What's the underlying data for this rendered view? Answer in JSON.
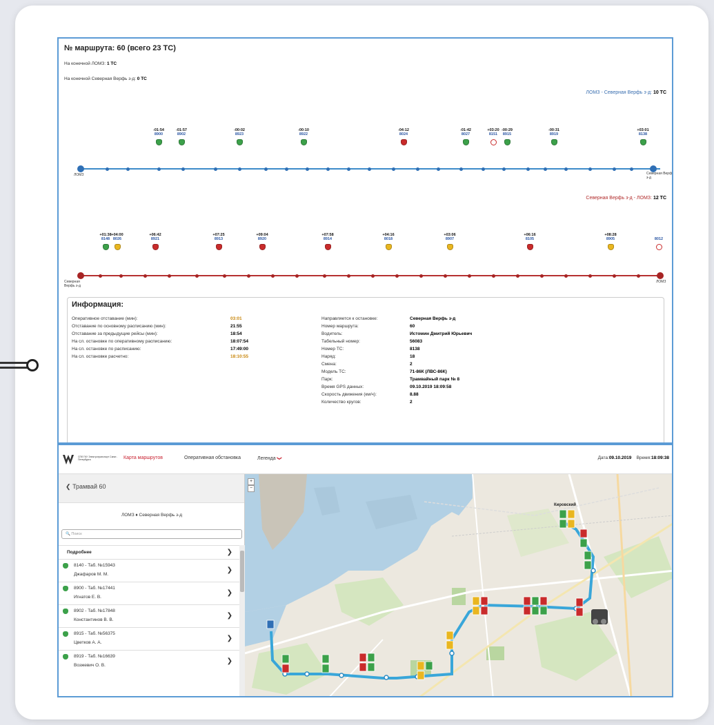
{
  "route_panel": {
    "title": "№ маршрута: 60 (всего 23 ТС)",
    "terminal_1_label": "На конечной ЛОМЗ:",
    "terminal_1_value": "1 ТС",
    "terminal_2_label": "На конечной Северная Верфь з-д:",
    "terminal_2_value": "0 ТС",
    "direction_1_label": "ЛОМЗ - Северная Верфь з-д:",
    "direction_1_count": "10 ТС",
    "direction_1_start": "ЛОМЗ",
    "direction_1_end": "Северная Верфь з-д",
    "direction_2_label": "Северная Верфь з-д - ЛОМЗ:",
    "direction_2_count": "12 ТС",
    "direction_2_start": "Северная Верфь з-д",
    "direction_2_end": "ЛОМЗ"
  },
  "direction_1_vehicles": [
    {
      "dev": "-01:54",
      "num": "8900",
      "status": "green"
    },
    {
      "dev": "-01:57",
      "num": "8902",
      "status": "green"
    },
    {
      "dev": "-00:02",
      "num": "8923",
      "status": "green"
    },
    {
      "dev": "-00:10",
      "num": "8922",
      "status": "green"
    },
    {
      "dev": "-04:12",
      "num": "8024",
      "status": "red"
    },
    {
      "dev": "-01:42",
      "num": "8027",
      "status": "green"
    },
    {
      "dev": "+03:20",
      "num": "8151",
      "status": "circle"
    },
    {
      "dev": "-00:29",
      "num": "8915",
      "status": "green"
    },
    {
      "dev": "-00:31",
      "num": "8919",
      "status": "green"
    },
    {
      "dev": "+03:01",
      "num": "8138",
      "status": "green"
    }
  ],
  "direction_2_vehicles": [
    {
      "dev": "+01:38",
      "num": "8148",
      "status": "green"
    },
    {
      "dev": "+04:00",
      "num": "8026",
      "status": "yellow"
    },
    {
      "dev": "+06:42",
      "num": "8921",
      "status": "red"
    },
    {
      "dev": "+07:25",
      "num": "8913",
      "status": "red"
    },
    {
      "dev": "+09:04",
      "num": "8920",
      "status": "red"
    },
    {
      "dev": "+07:58",
      "num": "8914",
      "status": "red"
    },
    {
      "dev": "+04:16",
      "num": "8018",
      "status": "yellow"
    },
    {
      "dev": "+03:06",
      "num": "8907",
      "status": "yellow"
    },
    {
      "dev": "+06:16",
      "num": "8105",
      "status": "red"
    },
    {
      "dev": "+08:28",
      "num": "8905",
      "status": "yellow"
    },
    {
      "dev": "",
      "num": "8012",
      "status": "circle"
    }
  ],
  "info": {
    "title": "Информация:",
    "left": [
      {
        "label": "Оперативное отставание (мин):",
        "value": "03:01",
        "color": "#c8860c"
      },
      {
        "label": "Отставание по основному расписанию (мин):",
        "value": "21:55",
        "color": "#000"
      },
      {
        "label": "Отставание за предыдущие рейсы (мин):",
        "value": "18:54",
        "color": "#000"
      },
      {
        "label": "На сл. остановке по оперативному расписанию:",
        "value": "18:07:54",
        "color": "#000"
      },
      {
        "label": "На сл. остановке по расписанию:",
        "value": "17:49:00",
        "color": "#000"
      },
      {
        "label": "На сл. остановке расчетно:",
        "value": "18:10:55",
        "color": "#c8860c"
      }
    ],
    "right": [
      {
        "label": "Направляется к остановке:",
        "value": "Северная Верфь з-д"
      },
      {
        "label": "Номер маршрута:",
        "value": "60"
      },
      {
        "label": "Водитель:",
        "value": "Истомин Дмитрий Юрьевич"
      },
      {
        "label": "Табельный номер:",
        "value": "56083"
      },
      {
        "label": "Номер ТС:",
        "value": "8138"
      },
      {
        "label": "Наряд:",
        "value": "18"
      },
      {
        "label": "Смена:",
        "value": "2"
      },
      {
        "label": "Модель ТС:",
        "value": "71-86К (ЛВС-86К)"
      },
      {
        "label": "Парк:",
        "value": "Трамвайный парк № 8"
      },
      {
        "label": "Время GPS данных:",
        "value": "09.10.2019 18:09:58"
      },
      {
        "label": "Скорость движения (км/ч):",
        "value": "8.88"
      },
      {
        "label": "Количество кругов:",
        "value": "2"
      }
    ]
  },
  "navbar": {
    "logo_text": "СПб ГКУ Электротранспорт Санкт-Петербурга",
    "tab_map": "Карта маршрутов",
    "tab_ops": "Оперативная обстановка",
    "legend": "Легенда",
    "legend_chevron": "❯",
    "date_label": "Дата:",
    "date_value": "09.10.2019",
    "time_label": "Время:",
    "time_value": "18:09:38"
  },
  "sidebar": {
    "back_label": "Трамвай 60",
    "back_chevron": "❮",
    "route": "ЛОМЗ ♦ Северная Верфь з-д",
    "search_placeholder": "Поиск",
    "details_label": "Подробнее",
    "arrow": "❯",
    "items": [
      {
        "line1": "8140 - Таб. №15943",
        "line2": "Джафаров М. М."
      },
      {
        "line1": "8900 - Таб. №17441",
        "line2": "Игнатов Е. В."
      },
      {
        "line1": "8902 - Таб. №17848",
        "line2": "Константинов В. В."
      },
      {
        "line1": "8915 - Таб. №56375",
        "line2": "Цветков А. А."
      },
      {
        "line1": "8919 - Таб. №16639",
        "line2": "Возжевич О. В."
      }
    ]
  },
  "map": {
    "zoom_in": "+",
    "zoom_out": "−",
    "district": "Кировский"
  },
  "colors": {
    "accent_blue": "#5b9bd5",
    "route_blue": "#3c8ac9",
    "route_red": "#b53030",
    "status_green": "#3ca14a",
    "status_red": "#c92b2b",
    "status_yellow": "#e9b620",
    "nav_active": "#c8202f"
  }
}
